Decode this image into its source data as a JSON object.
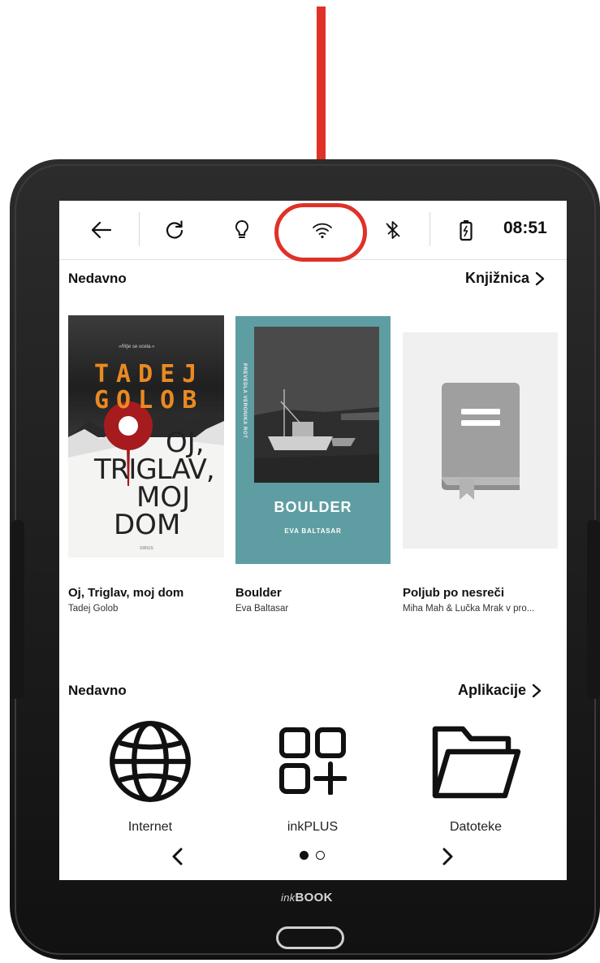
{
  "status_bar": {
    "icons": [
      "back-arrow-icon",
      "refresh-icon",
      "lightbulb-icon",
      "wifi-icon",
      "bluetooth-icon",
      "battery-icon"
    ],
    "time": "08:51"
  },
  "recent_books": {
    "title": "Nedavno",
    "link_label": "Knjižnica",
    "items": [
      {
        "title": "Oj, Triglav, moj dom",
        "author": "Tadej Golob"
      },
      {
        "title": "Boulder",
        "author": "Eva Baltasar"
      },
      {
        "title": "Poljub po nesreči",
        "author": "Miha Mah & Lučka Mrak v pro..."
      }
    ]
  },
  "cover_oj": {
    "tagline": "»Ritje se ocela.«",
    "author_line1": "TADEJ",
    "author_line2": "GOLOB",
    "title_line1": "OJ,",
    "title_line2": "TRIGLAV,",
    "title_line3": "MOJ",
    "title_line4": "DOM",
    "publisher": "SIRIUS"
  },
  "cover_boulder": {
    "title": "BOULDER",
    "author": "EVA BALTASAR",
    "side_text": "PREVEDLA VERONIKA ROT"
  },
  "recent_apps": {
    "title": "Nedavno",
    "link_label": "Aplikacije",
    "items": [
      {
        "label": "Internet",
        "icon": "globe-icon"
      },
      {
        "label": "inkPLUS",
        "icon": "grid-plus-icon"
      },
      {
        "label": "Datoteke",
        "icon": "folder-icon"
      }
    ]
  },
  "pagination": {
    "current_page": 1,
    "total_pages": 2
  },
  "device": {
    "brand_prefix": "ink",
    "brand_main": "BOOK"
  },
  "colors": {
    "annotation": "#e03128",
    "boulder_cover": "#5e9ea2"
  }
}
